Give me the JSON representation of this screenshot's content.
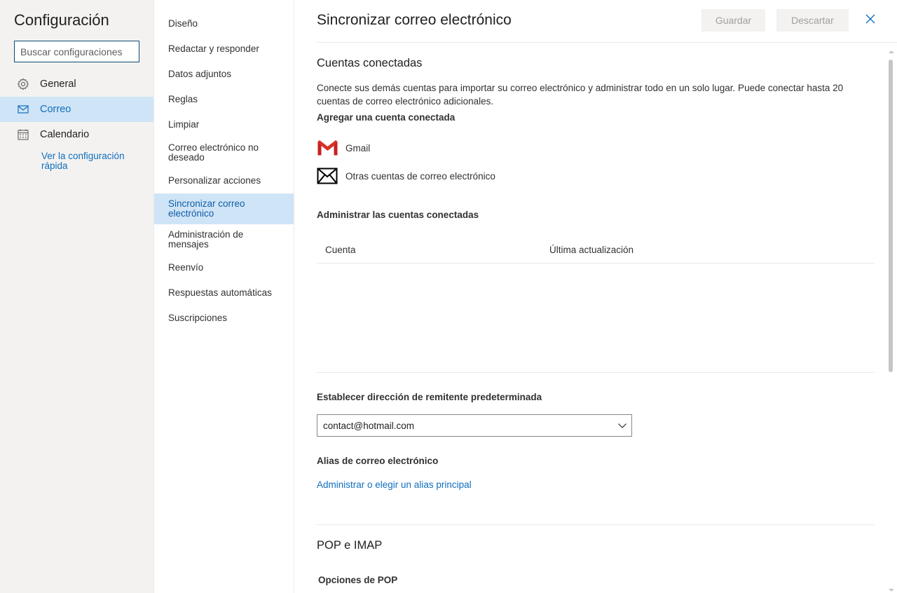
{
  "left": {
    "title": "Configuración",
    "search_placeholder": "Buscar configuraciones",
    "items": [
      {
        "label": "General",
        "icon": "gear-icon"
      },
      {
        "label": "Correo",
        "icon": "mail-icon"
      },
      {
        "label": "Calendario",
        "icon": "calendar-icon"
      }
    ],
    "quick_link": "Ver la configuración rápida"
  },
  "nav": {
    "items": [
      "Diseño",
      "Redactar y responder",
      "Datos adjuntos",
      "Reglas",
      "Limpiar",
      "Correo electrónico no deseado",
      "Personalizar acciones",
      "Sincronizar correo electrónico",
      "Administración de mensajes",
      "Reenvío",
      "Respuestas automáticas",
      "Suscripciones"
    ],
    "selected": "Sincronizar correo electrónico"
  },
  "main": {
    "title": "Sincronizar correo electrónico",
    "save_label": "Guardar",
    "discard_label": "Descartar",
    "connected": {
      "heading": "Cuentas conectadas",
      "description": "Conecte sus demás cuentas para importar su correo electrónico y administrar todo en un solo lugar. Puede conectar hasta 20 cuentas de correo electrónico adicionales.",
      "add_heading": "Agregar una cuenta conectada",
      "providers": [
        {
          "label": "Gmail",
          "icon": "gmail-icon"
        },
        {
          "label": "Otras cuentas de correo electrónico",
          "icon": "envelope-icon"
        }
      ],
      "manage_heading": "Administrar las cuentas conectadas",
      "columns": [
        "Cuenta",
        "Última actualización"
      ]
    },
    "default_sender": {
      "heading": "Establecer dirección de remitente predeterminada",
      "value": "contact@hotmail.com"
    },
    "alias": {
      "heading": "Alias de correo electrónico",
      "link": "Administrar o elegir un alias principal"
    },
    "pop": {
      "heading": "POP e IMAP",
      "sub": "Opciones de POP"
    }
  },
  "colors": {
    "accent": "#106ebe",
    "selected_bg": "#cfe4f6",
    "gmail_red": "#d93025"
  }
}
